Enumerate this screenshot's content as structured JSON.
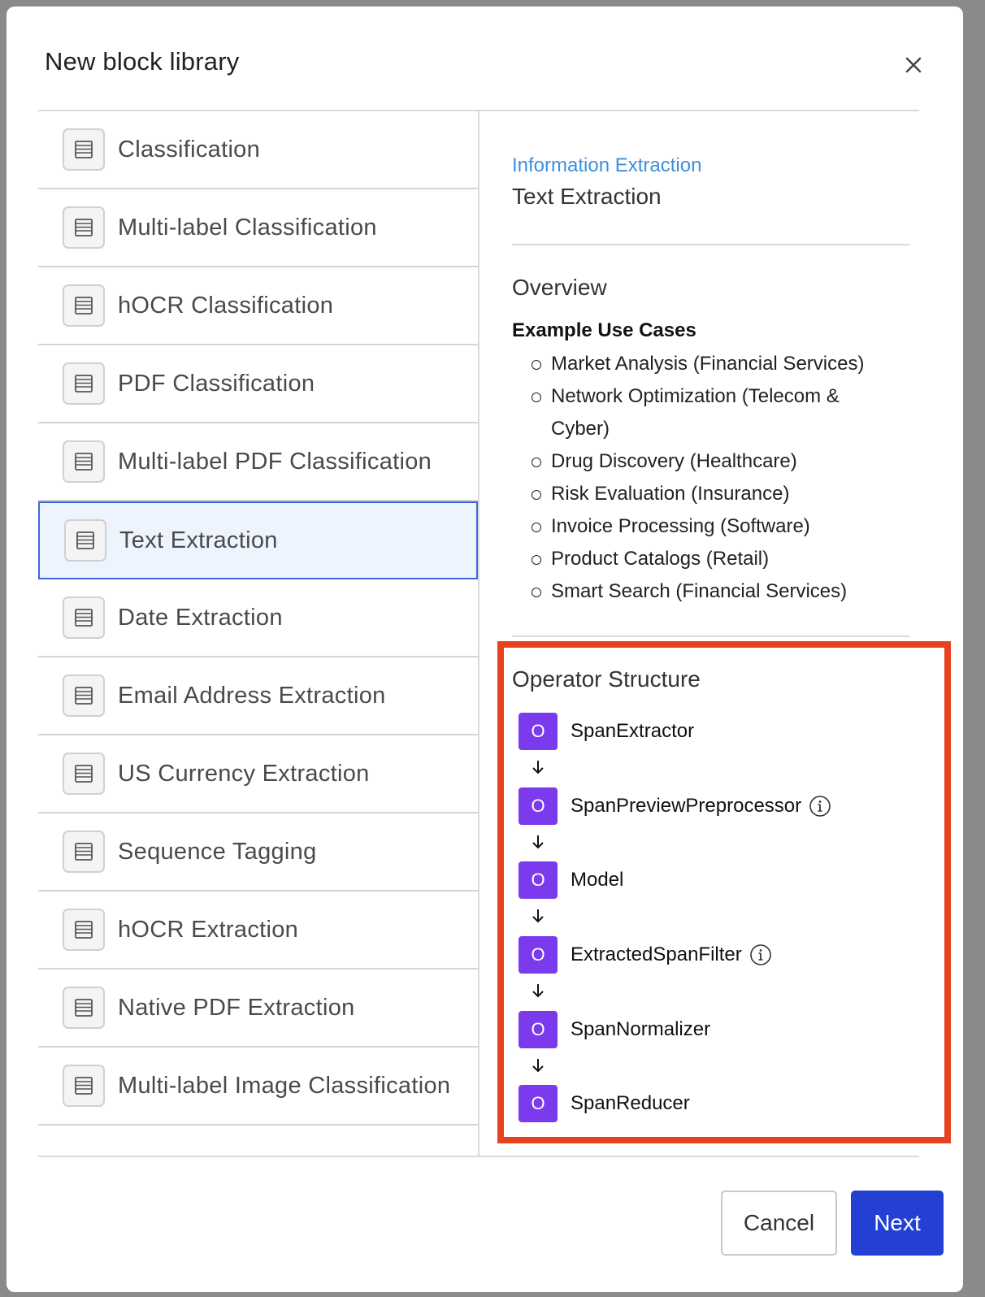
{
  "modal": {
    "title": "New block library",
    "cancel_label": "Cancel",
    "next_label": "Next"
  },
  "blocks": [
    {
      "label": "Classification"
    },
    {
      "label": "Multi-label Classification"
    },
    {
      "label": "hOCR Classification"
    },
    {
      "label": "PDF Classification"
    },
    {
      "label": "Multi-label PDF Classification"
    },
    {
      "label": "Text Extraction",
      "selected": true
    },
    {
      "label": "Date Extraction"
    },
    {
      "label": "Email Address Extraction"
    },
    {
      "label": "US Currency Extraction"
    },
    {
      "label": "Sequence Tagging"
    },
    {
      "label": "hOCR Extraction"
    },
    {
      "label": "Native PDF Extraction"
    },
    {
      "label": "Multi-label Image Classification"
    }
  ],
  "detail": {
    "breadcrumb": "Information Extraction",
    "title": "Text Extraction",
    "overview_title": "Overview",
    "use_cases_title": "Example Use Cases",
    "use_cases": [
      "Market Analysis (Financial Services)",
      "Network Optimization (Telecom & Cyber)",
      "Drug Discovery (Healthcare)",
      "Risk Evaluation (Insurance)",
      "Invoice Processing (Software)",
      "Product Catalogs (Retail)",
      "Smart Search (Financial Services)"
    ],
    "operator_title": "Operator Structure",
    "operators": [
      {
        "badge": "O",
        "name": "SpanExtractor",
        "info": false
      },
      {
        "badge": "O",
        "name": "SpanPreviewPreprocessor",
        "info": true
      },
      {
        "badge": "O",
        "name": "Model",
        "info": false
      },
      {
        "badge": "O",
        "name": "ExtractedSpanFilter",
        "info": true
      },
      {
        "badge": "O",
        "name": "SpanNormalizer",
        "info": false
      },
      {
        "badge": "O",
        "name": "SpanReducer",
        "info": false
      }
    ]
  },
  "colors": {
    "accent": "#2340d2",
    "selected_border": "#3b66e0",
    "selected_bg": "#eef4fe",
    "operator_badge": "#7c3aed",
    "highlight": "#e8421f",
    "link": "#3d8fe0"
  }
}
